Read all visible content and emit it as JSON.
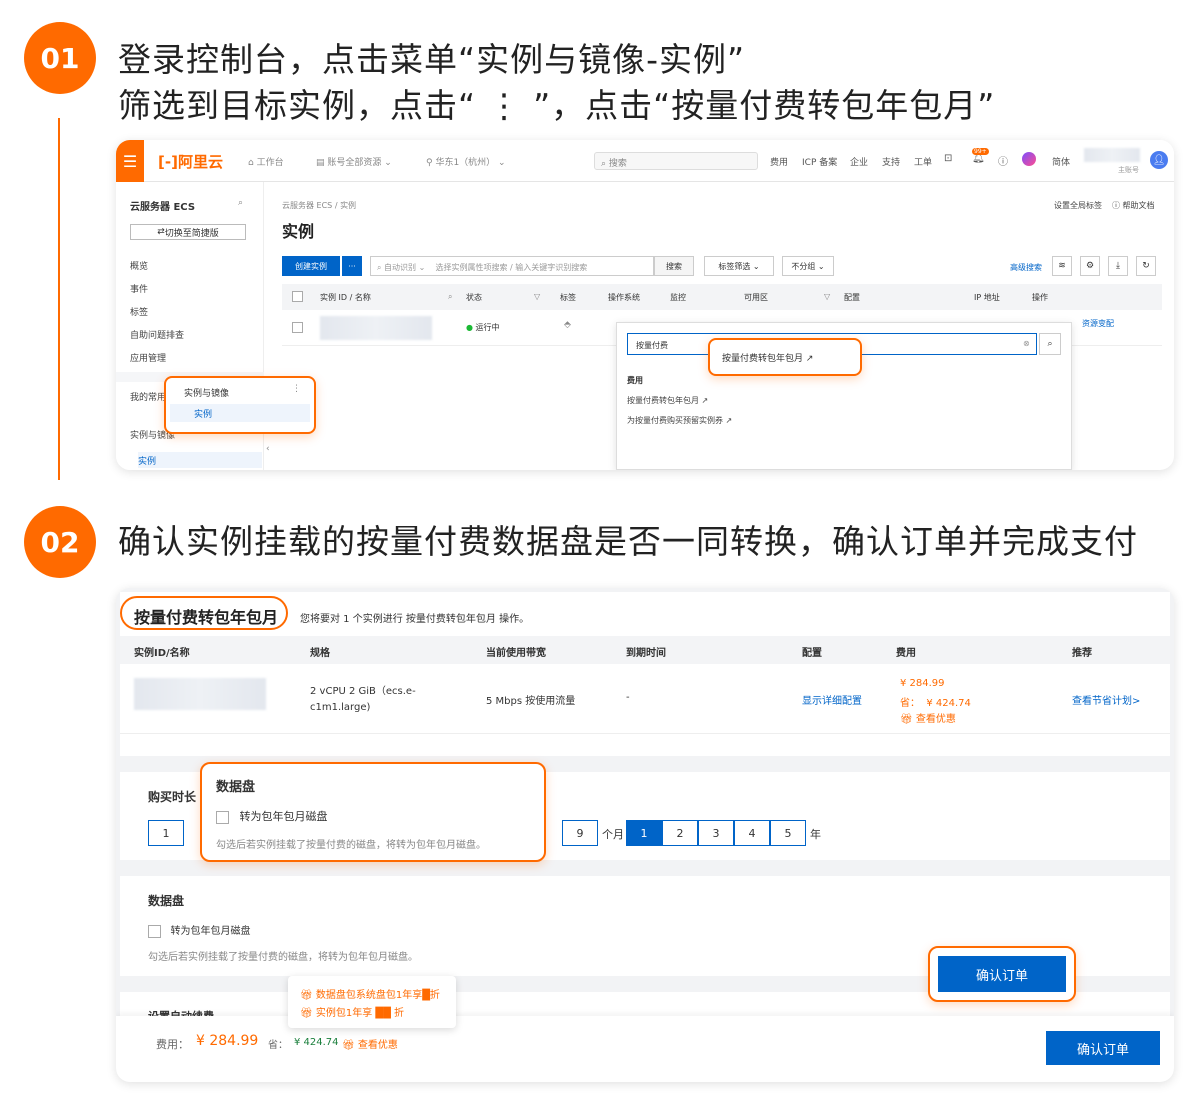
{
  "step1": {
    "num": "01",
    "title_line1": "登录控制台，点击菜单“实例与镜像-实例”",
    "title_line2": "筛选到目标实例，点击“ ⋮ ”，点击“按量付费转包年包月”"
  },
  "step2": {
    "num": "02",
    "title": "确认实例挂载的按量付费数据盘是否一同转换，确认订单并完成支付"
  },
  "console": {
    "logo": "阿里云",
    "nav": {
      "workbench": "工作台",
      "resources": "账号全部资源",
      "region": "华东1（杭州）",
      "search": "搜索",
      "links": [
        "费用",
        "ICP 备案",
        "企业",
        "支持",
        "工单"
      ],
      "badge": "99+",
      "lang": "简体",
      "account": "主账号"
    },
    "sidebar": {
      "title": "云服务器 ECS",
      "switch_btn": "切换至简捷版",
      "items": [
        "概览",
        "事件",
        "标签",
        "自助问题排查",
        "应用管理"
      ],
      "fav": "我的常用",
      "group": "实例与镜像",
      "active": "实例",
      "popup_group": "实例与镜像",
      "popup_item": "实例"
    },
    "main": {
      "breadcrumb1": "云服务器 ECS",
      "breadcrumb_sep": "/",
      "breadcrumb2": "实例",
      "page_title": "实例",
      "top_right1": "设置全局标签",
      "top_right2": "帮助文档",
      "create_btn": "创建实例",
      "more_btn": "···",
      "filter_select": "自动识别",
      "filter_placeholder": "选择实例属性项搜索 / 输入关键字识别搜索",
      "search_btn": "搜索",
      "tag_filter": "标签筛选",
      "group_filter": "不分组",
      "advanced": "高级搜索",
      "columns": [
        "实例 ID / 名称",
        "状态",
        "标签",
        "操作系统",
        "监控",
        "可用区",
        "配置",
        "IP 地址",
        "操作"
      ],
      "status": "运行中",
      "ops_link": "资源变配",
      "dropdown_input": "按量付费",
      "dropdown_section": "费用",
      "dropdown_items": [
        "按量付费转包年包月",
        "为按量付费购买预留实例券"
      ],
      "callout_item": "按量付费转包年包月"
    }
  },
  "order": {
    "title": "按量付费转包年包月",
    "desc": "您将要对 1 个实例进行 按量付费转包年包月 操作。",
    "columns": [
      "实例ID/名称",
      "规格",
      "当前使用带宽",
      "到期时间",
      "配置",
      "费用",
      "推荐"
    ],
    "row": {
      "spec_line1": "2 vCPU 2 GiB（ecs.e-",
      "spec_line2": "c1m1.large)",
      "bandwidth": "5 Mbps 按使用流量",
      "expire": "-",
      "config": "显示详细配置",
      "price": "¥ 284.99",
      "save_label": "省：",
      "save": "¥ 424.74",
      "promo": "查看优惠",
      "recommend": "查看节省计划>"
    },
    "duration_label": "购买时长",
    "month_values": [
      "1",
      "9"
    ],
    "month_unit": "个月",
    "year_values": [
      "1",
      "2",
      "3",
      "4",
      "5"
    ],
    "year_unit": "年",
    "disk_title": "数据盘",
    "disk_checkbox": "转为包年包月磁盘",
    "disk_hint": "勾选后若实例挂载了按量付费的磁盘，将转为包年包月磁盘。",
    "auto_renew": "设置自动续费",
    "promo_tip1": "数据盘包系统盘包1年享█折",
    "promo_tip2": "实例包1年享 ██ 折",
    "footer_fee_label": "费用：",
    "footer_fee": "¥ 284.99",
    "footer_save_label": "省：",
    "footer_save": "¥ 424.74",
    "footer_promo": "查看优惠",
    "confirm_btn": "确认订单"
  }
}
